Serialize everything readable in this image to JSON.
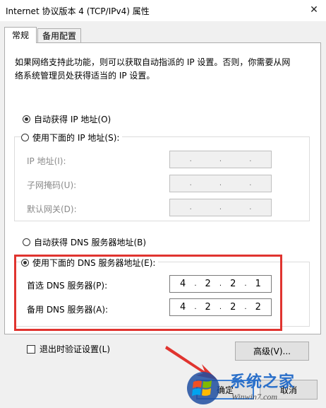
{
  "window": {
    "title": "Internet 协议版本 4 (TCP/IPv4) 属性",
    "close_symbol": "✕"
  },
  "tabs": [
    {
      "label": "常规"
    },
    {
      "label": "备用配置"
    }
  ],
  "intro": {
    "line1": "如果网络支持此功能，则可以获取自动指派的 IP 设置。否则，你需要从网",
    "line2": "络系统管理员处获得适当的 IP 设置。"
  },
  "ip": {
    "auto_label": "自动获得 IP 地址(O)",
    "manual_label": "使用下面的 IP 地址(S):",
    "address_label": "IP 地址(I):",
    "subnet_label": "子网掩码(U):",
    "gateway_label": "默认网关(D):",
    "dot": "."
  },
  "dns": {
    "auto_label": "自动获得 DNS 服务器地址(B)",
    "manual_label": "使用下面的 DNS 服务器地址(E):",
    "preferred_label": "首选 DNS 服务器(P):",
    "preferred_octets": [
      "4",
      "2",
      "2",
      "1"
    ],
    "alternate_label": "备用 DNS 服务器(A):",
    "alternate_octets": [
      "4",
      "2",
      "2",
      "2"
    ]
  },
  "validate_label": "退出时验证设置(L)",
  "buttons": {
    "advanced": "高级(V)...",
    "ok": "确定",
    "cancel": "取消"
  },
  "watermark": {
    "brand_cn": "系统之家",
    "url": "Winwin7.com"
  },
  "colors": {
    "highlight": "#e0342f",
    "arrow": "#e0342f"
  }
}
